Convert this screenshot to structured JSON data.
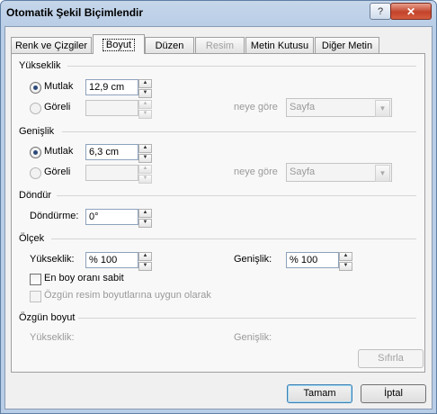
{
  "window": {
    "title": "Otomatik Şekil Biçimlendir",
    "help_label": "?",
    "close_label": "✕"
  },
  "tabs": [
    {
      "label": "Renk ve Çizgiler",
      "state": "normal"
    },
    {
      "label": "Boyut",
      "state": "selected"
    },
    {
      "label": "Düzen",
      "state": "normal"
    },
    {
      "label": "Resim",
      "state": "disabled"
    },
    {
      "label": "Metin Kutusu",
      "state": "normal"
    },
    {
      "label": "Diğer Metin",
      "state": "normal"
    }
  ],
  "height_group": {
    "title": "Yükseklik",
    "absolute": {
      "label": "Mutlak",
      "value": "12,9 cm",
      "checked": true
    },
    "relative": {
      "label": "Göreli",
      "value": "",
      "checked": false
    },
    "relative_to_label": "neye göre",
    "relative_to_value": "Sayfa"
  },
  "width_group": {
    "title": "Genişlik",
    "absolute": {
      "label": "Mutlak",
      "value": "6,3 cm",
      "checked": true
    },
    "relative": {
      "label": "Göreli",
      "value": "",
      "checked": false
    },
    "relative_to_label": "neye göre",
    "relative_to_value": "Sayfa"
  },
  "rotate_group": {
    "title": "Döndür",
    "rotation_label": "Döndürme:",
    "rotation_value": "0°"
  },
  "scale_group": {
    "title": "Ölçek",
    "height_label": "Yükseklik:",
    "height_value": "% 100",
    "width_label": "Genişlik:",
    "width_value": "% 100",
    "lock_aspect_label": "En boy oranı sabit",
    "lock_aspect_checked": false,
    "relative_original_label": "Özgün resim boyutlarına uygun olarak",
    "relative_original_checked": false
  },
  "original_size_group": {
    "title": "Özgün boyut",
    "height_label": "Yükseklik:",
    "width_label": "Genişlik:",
    "reset_label": "Sıfırla"
  },
  "footer": {
    "ok_label": "Tamam",
    "cancel_label": "İptal"
  }
}
